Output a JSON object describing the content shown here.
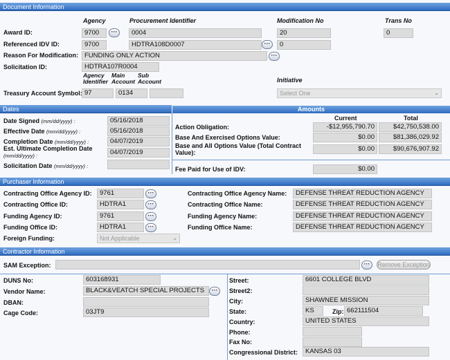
{
  "document_info": {
    "header": "Document Information",
    "col_agency": "Agency",
    "col_proc_id": "Procurement Identifier",
    "col_mod_no": "Modification No",
    "col_trans_no": "Trans No",
    "award_id_label": "Award ID:",
    "award_agency": "9700",
    "award_proc_id": "0004",
    "award_mod_no": "20",
    "award_trans_no": "0",
    "ref_idv_label": "Referenced IDV ID:",
    "ref_agency": "9700",
    "ref_proc_id": "HDTRA108D0007",
    "ref_mod_no": "0",
    "reason_label": "Reason For Modification:",
    "reason_value": "FUNDING ONLY ACTION",
    "solicitation_label": "Solicitation ID:",
    "solicitation_value": "HDTRA107R0004",
    "tas_col_agency": "Agency Identifier",
    "tas_col_main": "Main Account",
    "tas_col_sub": "Sub Account",
    "tas_label": "Treasury Account Symbol:",
    "tas_agency": "97",
    "tas_main": "0134",
    "tas_sub": "",
    "initiative_label": "Initiative",
    "initiative_value": "Select One"
  },
  "dates": {
    "header": "Dates",
    "signed_label": "Date Signed",
    "signed_fmt": "(mm/dd/yyyy) :",
    "signed_value": "05/16/2018",
    "effective_label": "Effective Date",
    "effective_fmt": "(mm/dd/yyyy) :",
    "effective_value": "05/16/2018",
    "completion_label": "Completion Date",
    "completion_fmt": "(mm/dd/yyyy) :",
    "completion_value": "04/07/2019",
    "est_label": "Est. Ultimate Completion Date",
    "est_fmt": "(mm/dd/yyyy) :",
    "est_value": "04/07/2019",
    "solicitation_date_label": "Solicitation Date",
    "solicitation_date_fmt": "(mm/dd/yyyy) :",
    "solicitation_date_value": ""
  },
  "amounts": {
    "header": "Amounts",
    "col_current": "Current",
    "col_total": "Total",
    "action_label": "Action Obligation:",
    "action_current": "-$12,955,790.70",
    "action_total": "$42,750,538.00",
    "base_ex_label": "Base And Exercised Options Value:",
    "base_ex_current": "$0.00",
    "base_ex_total": "$81,386,029.92",
    "base_all_label": "Base and All Options Value (Total Contract Value):",
    "base_all_current": "$0.00",
    "base_all_total": "$90,676,907.92",
    "fee_label": "Fee Paid for Use of IDV:",
    "fee_value": "$0.00"
  },
  "purchaser": {
    "header": "Purchaser Information",
    "co_agency_id_label": "Contracting Office Agency ID:",
    "co_agency_id": "9761",
    "co_id_label": "Contracting Office ID:",
    "co_id": "HDTRA1",
    "funding_agency_id_label": "Funding Agency ID:",
    "funding_agency_id": "9761",
    "funding_office_id_label": "Funding Office ID:",
    "funding_office_id": "HDTRA1",
    "foreign_funding_label": "Foreign Funding:",
    "foreign_funding": "Not Applicable",
    "co_agency_name_label": "Contracting Office Agency Name:",
    "co_agency_name": "DEFENSE THREAT REDUCTION AGENCY",
    "co_name_label": "Contracting Office Name:",
    "co_name": "DEFENSE THREAT REDUCTION AGENCY",
    "funding_agency_name_label": "Funding Agency Name:",
    "funding_agency_name": "DEFENSE THREAT REDUCTION AGENCY",
    "funding_office_name_label": "Funding Office Name:",
    "funding_office_name": "DEFENSE THREAT REDUCTION AGENCY"
  },
  "contractor": {
    "header": "Contractor Information",
    "sam_label": "SAM Exception:",
    "sam_value": "",
    "remove_exception": "Remove Exception",
    "duns_label": "DUNS No:",
    "duns": "603168931",
    "vendor_label": "Vendor Name:",
    "vendor": "BLACK&VEATCH SPECIAL PROJECTS",
    "dban_label": "DBAN:",
    "dban": "",
    "cage_label": "Cage Code:",
    "cage": "03JT9",
    "street_label": "Street:",
    "street": "6601 COLLEGE BLVD",
    "street2_label": "Street2:",
    "street2": "",
    "city_label": "City:",
    "city": "SHAWNEE MISSION",
    "state_label": "State:",
    "state": "KS",
    "zip_label": "Zip:",
    "zip": "662111504",
    "country_label": "Country:",
    "country": "UNITED STATES",
    "phone_label": "Phone:",
    "phone": "",
    "fax_label": "Fax No:",
    "fax": "",
    "district_label": "Congressional District:",
    "district": "KANSAS 03"
  },
  "icons": {
    "lookup": "more-dots-icon",
    "dropdown": "chevron-down-icon"
  },
  "colors": {
    "section_header": "#2f6cc1",
    "field_bg": "#dcdcdc",
    "page_bg": "#f7f8fb"
  }
}
